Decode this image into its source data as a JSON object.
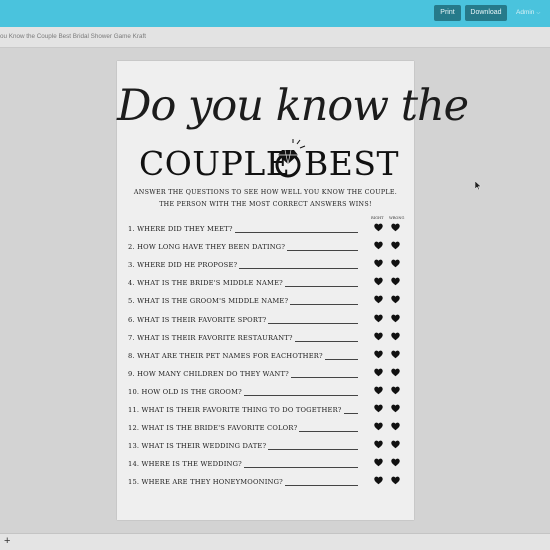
{
  "toolbar": {
    "print_label": "Print",
    "download_label": "Download",
    "admin_label": "Admin"
  },
  "breadcrumb": {
    "text": "ou Know the Couple Best Bridal Shower Game Kraft"
  },
  "sheet": {
    "title_script": "Do you know the",
    "title_word1": "COUPLE",
    "title_word2": "BEST",
    "instructions_line1": "ANSWER THE QUESTIONS TO SEE HOW WELL YOU KNOW THE COUPLE.",
    "instructions_line2": "THE PERSON WITH THE MOST CORRECT ANSWERS WINS!",
    "col_right": "RIGHT",
    "col_wrong": "WRONG",
    "questions": [
      "1. WHERE DID THEY MEET?",
      "2. HOW LONG HAVE THEY BEEN DATING?",
      "3. WHERE DID HE PROPOSE?",
      "4. WHAT IS THE BRIDE'S MIDDLE NAME?",
      "5. WHAT IS THE GROOM'S MIDDLE NAME?",
      "6. WHAT IS THEIR FAVORITE SPORT?",
      "7. WHAT IS THEIR FAVORITE RESTAURANT?",
      "8. WHAT ARE THEIR PET NAMES FOR EACHOTHER?",
      "9. HOW MANY CHILDREN DO THEY WANT?",
      "10. HOW OLD IS THE GROOM?",
      "11. WHAT IS THEIR FAVORITE THING TO DO TOGETHER?",
      "12. WHAT IS THE BRIDE'S FAVORITE COLOR?",
      "13. WHAT IS THEIR WEDDING DATE?",
      "14. WHERE IS THE WEDDING?",
      "15. WHERE ARE THEY HONEYMOONING?"
    ]
  },
  "bottombar": {
    "add_label": "+"
  },
  "colors": {
    "topbar": "#4ac3dd",
    "button": "#267a8a",
    "ink": "#1a1a1a"
  },
  "icons": {
    "ring": "diamond-ring-icon",
    "heart": "heart-icon",
    "cursor": "mouse-cursor-icon",
    "admin_chevron": "chevron-down-icon"
  }
}
